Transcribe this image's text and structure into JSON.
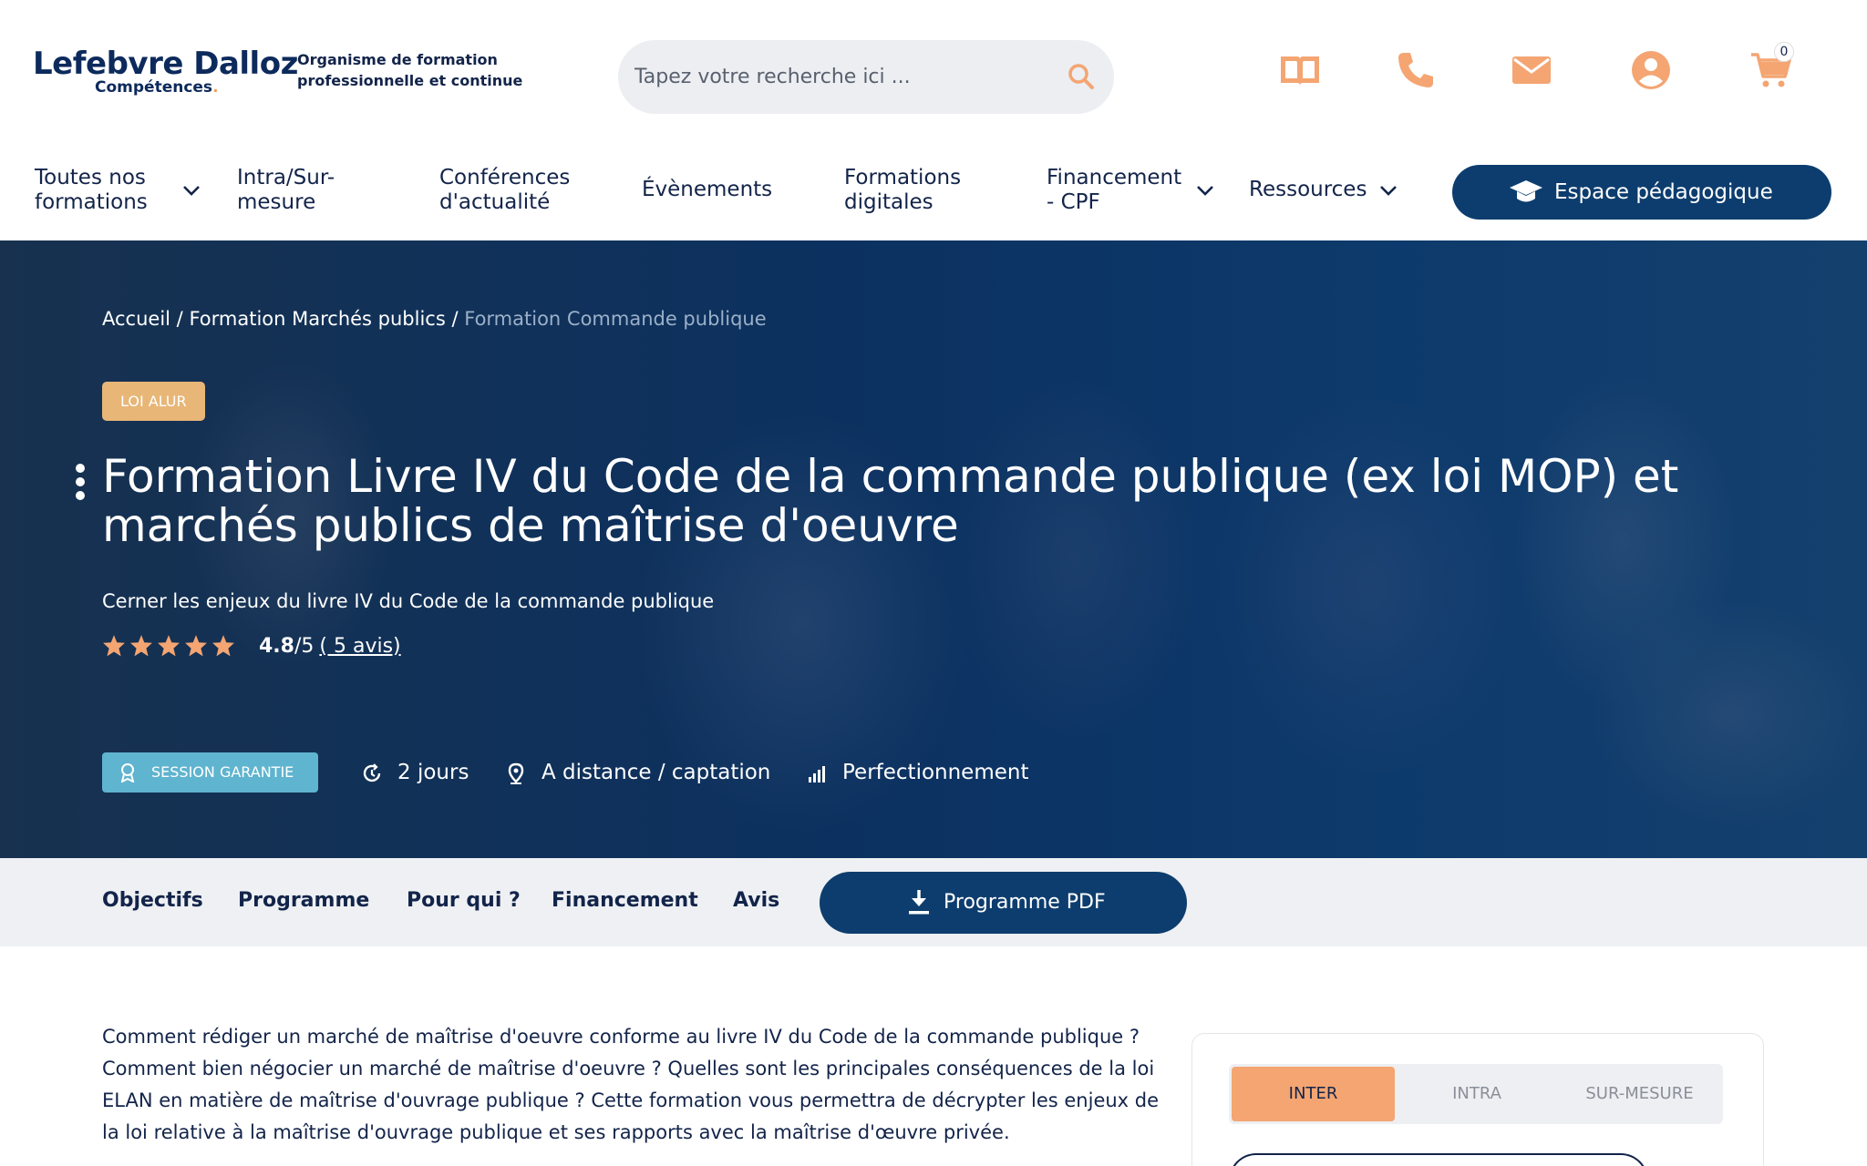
{
  "header": {
    "logo_main": "Lefebvre Dalloz",
    "logo_sub": "Compétences",
    "org_text": "Organisme de formation professionnelle et continue",
    "search_placeholder": "Tapez votre recherche ici ...",
    "cart_count": "0",
    "icons": [
      "book-icon",
      "phone-icon",
      "mail-icon",
      "user-icon",
      "cart-icon"
    ]
  },
  "nav": {
    "items": [
      {
        "label": "Toutes nos formations",
        "dropdown": true
      },
      {
        "label": "Intra/Sur-mesure",
        "dropdown": false
      },
      {
        "label": "Conférences d'actualité",
        "dropdown": false
      },
      {
        "label": "Évènements",
        "dropdown": false
      },
      {
        "label": "Formations digitales",
        "dropdown": false
      },
      {
        "label": "Financement - CPF",
        "dropdown": true
      },
      {
        "label": "Ressources",
        "dropdown": true
      }
    ],
    "espace_label": "Espace pédagogique"
  },
  "hero": {
    "breadcrumb": [
      "Accueil",
      "Formation Marchés publics",
      "Formation Commande publique"
    ],
    "badge": "LOI ALUR",
    "title": "Formation Livre IV du Code de la commande publique (ex loi MOP) et marchés publics de maîtrise d'oeuvre",
    "subtitle": "Cerner les enjeux du livre IV du Code de la commande publique",
    "rating_value": "4.8",
    "rating_max": "/5",
    "rating_count": "( 5 avis)",
    "stars": 5,
    "session_badge": "SESSION GARANTIE",
    "duration": "2 jours",
    "location": "A distance / captation",
    "level": "Perfectionnement"
  },
  "tabs": {
    "items": [
      "Objectifs",
      "Programme",
      "Pour qui ?",
      "Financement",
      "Avis"
    ],
    "pdf_label": "Programme PDF"
  },
  "content": {
    "intro": "Comment rédiger un marché de maîtrise d'oeuvre conforme au livre IV du Code de la commande publique ? Comment bien négocier un marché de maîtrise d'oeuvre ? Quelles sont les principales conséquences de la loi ELAN en matière de maîtrise d'ouvrage publique ? Cette formation vous permettra de décrypter les enjeux de la loi relative à la maîtrise d'ouvrage publique et ses rapports avec la maîtrise d'œuvre privée."
  },
  "sidebar": {
    "options": [
      "INTER",
      "INTRA",
      "SUR-MESURE"
    ],
    "active": "INTER"
  },
  "colors": {
    "navy": "#0d3d6e",
    "orange": "#f4a572",
    "gold": "#e8b677",
    "teal": "#5fb4cf"
  }
}
